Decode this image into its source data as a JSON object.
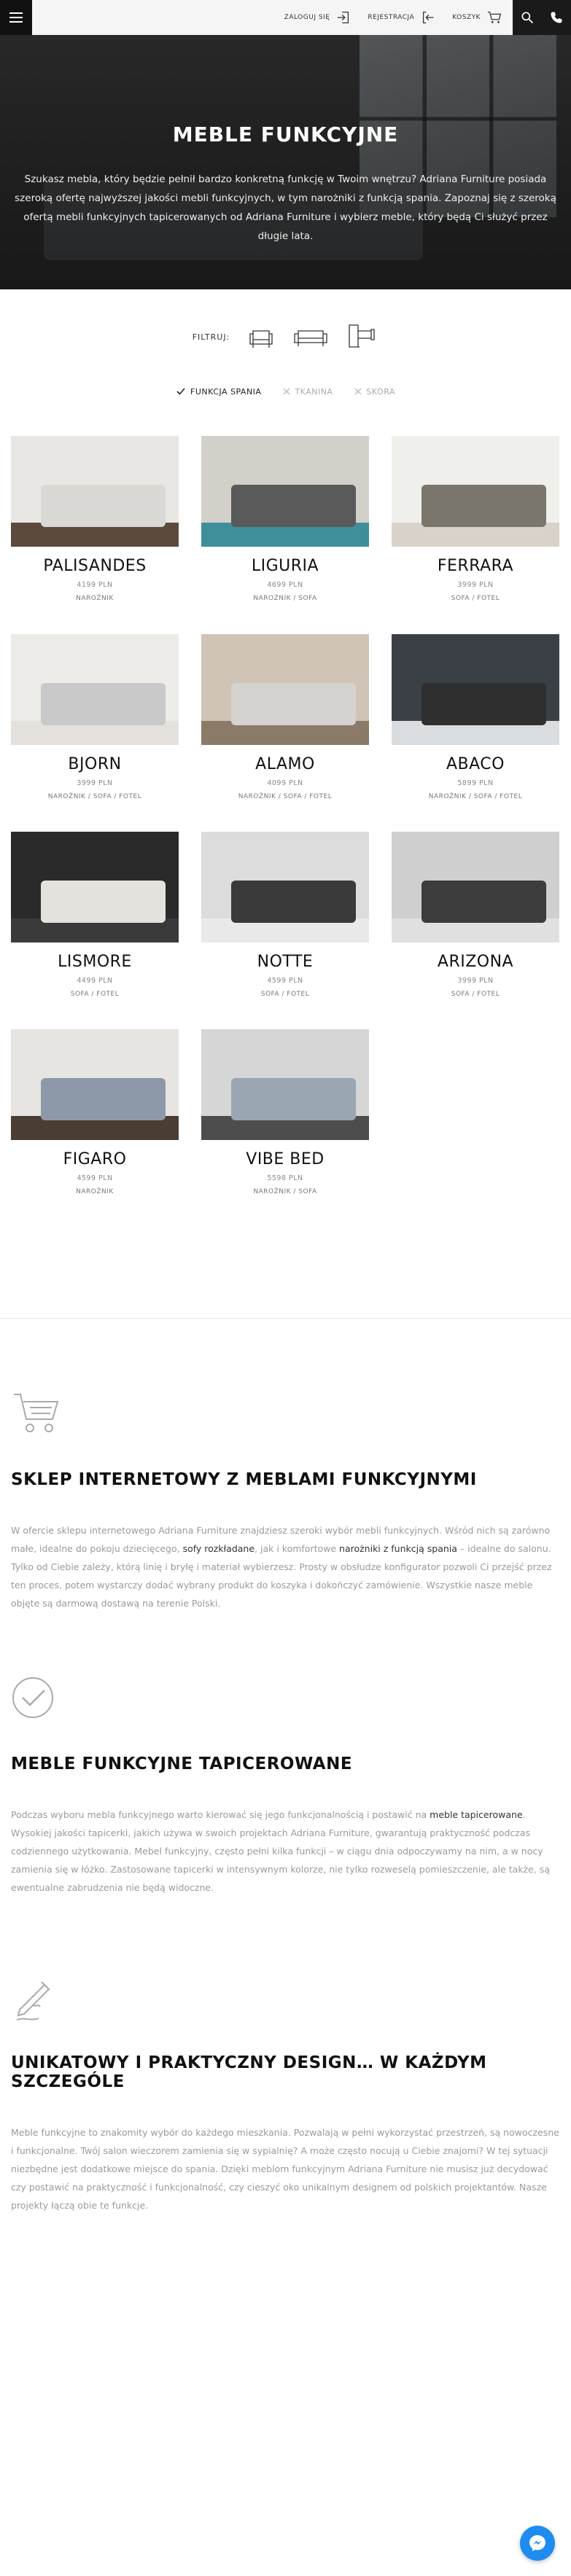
{
  "header": {
    "login_label": "ZALOGUJ SIĘ",
    "register_label": "REJESTRACJA",
    "cart_label": "KOSZYK"
  },
  "hero": {
    "title": "MEBLE FUNKCYJNE",
    "text": "Szukasz mebla, który będzie pełnił bardzo konkretną funkcję w Twoim wnętrzu? Adriana Furniture posiada szeroką ofertę najwyższej jakości mebli funkcyjnych, w tym narożniki z funkcją spania. Zapoznaj się z szeroką ofertą mebli funkcyjnych tapicerowanych od Adriana Furniture i wybierz meble, który będą Ci służyć przez długie lata."
  },
  "filter": {
    "label": "FILTRUJ:"
  },
  "tags": [
    {
      "label": "FUNKCJA SPANIA",
      "active": true
    },
    {
      "label": "TKANINA",
      "active": false
    },
    {
      "label": "SKÓRA",
      "active": false
    }
  ],
  "products": [
    {
      "name": "PALISANDES",
      "price": "4199 PLN",
      "type": "NAROŻNIK",
      "wall": "#e9e7e3",
      "sofa": "#d9d8d5",
      "floor": "#5b4a3d"
    },
    {
      "name": "LIGURIA",
      "price": "4699 PLN",
      "type": "NAROŻNIK / SOFA",
      "wall": "#d3d0ca",
      "sofa": "#5a5a5a",
      "floor": "#3f8f9b"
    },
    {
      "name": "FERRARA",
      "price": "3999 PLN",
      "type": "SOFA / FOTEL",
      "wall": "#efefec",
      "sofa": "#7a766c",
      "floor": "#d8d2c8"
    },
    {
      "name": "BJORN",
      "price": "3999 PLN",
      "type": "NAROŻNIK / SOFA / FOTEL",
      "wall": "#ecebe8",
      "sofa": "#c9c9c9",
      "floor": "#e4e1dc"
    },
    {
      "name": "ALAMO",
      "price": "4099 PLN",
      "type": "NAROŻNIK / SOFA / FOTEL",
      "wall": "#cfc4b6",
      "sofa": "#d5d3cf",
      "floor": "#8c7a68"
    },
    {
      "name": "ABACO",
      "price": "5899 PLN",
      "type": "NAROŻNIK / SOFA / FOTEL",
      "wall": "#3b3f46",
      "sofa": "#2f2f2f",
      "floor": "#d9dde0"
    },
    {
      "name": "LISMORE",
      "price": "4499 PLN",
      "type": "SOFA / FOTEL",
      "wall": "#2a2a2a",
      "sofa": "#e4e2dd",
      "floor": "#3a3a3a"
    },
    {
      "name": "NOTTE",
      "price": "4599 PLN",
      "type": "SOFA / FOTEL",
      "wall": "#dcdcdc",
      "sofa": "#3a3a3a",
      "floor": "#e9e9e9"
    },
    {
      "name": "ARIZONA",
      "price": "3999 PLN",
      "type": "SOFA / FOTEL",
      "wall": "#cfcfcf",
      "sofa": "#3c3c3c",
      "floor": "#e0e0e0"
    },
    {
      "name": "FIGARO",
      "price": "4599 PLN",
      "type": "NAROŻNIK",
      "wall": "#e7e5e1",
      "sofa": "#8d99a8",
      "floor": "#4a3d33"
    },
    {
      "name": "VIBE BED",
      "price": "5598 PLN",
      "type": "NAROŻNIK / SOFA",
      "wall": "#d6d6d6",
      "sofa": "#9aa6b1",
      "floor": "#4d4d4d"
    }
  ],
  "info": [
    {
      "icon": "cart-icon",
      "title": "SKLEP INTERNETOWY Z MEBLAMI FUNKCYJNYMI",
      "text_parts": [
        "W ofercie sklepu internetowego Adriana Furniture znajdziesz szeroki wybór mebli funkcyjnych. Wśród nich są zarówno małe, idealne do pokoju dziecięcego, ",
        "sofy rozkładane",
        ", jak i komfortowe ",
        "narożniki z funkcją spania",
        " – idealne do salonu. Tylko od Ciebie zależy, którą linię i bryłę i materiał wybierzesz. Prosty w obsłudze konfigurator pozwoli Ci przejść przez ten proces, potem wystarczy dodać wybrany produkt do koszyka i dokończyć zamówienie. Wszystkie nasze meble objęte są darmową dostawą na terenie Polski."
      ]
    },
    {
      "icon": "check-circle-icon",
      "title": "MEBLE FUNKCYJNE TAPICEROWANE",
      "text_parts": [
        "Podczas wyboru mebla funkcyjnego warto kierować się jego funkcjonalnością i postawić na ",
        "meble tapicerowane",
        ". Wysokiej jakości tapicerki, jakich używa w swoich projektach Adriana Furniture, gwarantują praktyczność podczas codziennego użytkowania. Mebel funkcyjny, często pełni kilka funkcji – w ciągu dnia odpoczywamy na nim, a w nocy zamienia się w łóżko. Zastosowane tapicerki w intensywnym kolorze, nie tylko rozweselą pomieszczenie, ale także, są ewentualne zabrudzenia nie będą widoczne."
      ]
    },
    {
      "icon": "pen-design-icon",
      "title": "UNIKATOWY I PRAKTYCZNY DESIGN… W KAŻDYM SZCZEGÓLE",
      "text_parts": [
        "Meble funkcyjne to znakomity wybór do każdego mieszkania. Pozwalają w pełni wykorzystać przestrzeń, są nowoczesne i funkcjonalne. Twój salon wieczorem zamienia się w sypialnię? A może często nocują u Ciebie znajomi? W tej sytuacji niezbędne jest dodatkowe miejsce do spania. Dzięki meblom funkcyjnym Adriana Furniture nie musisz już decydować czy postawić na praktyczność i funkcjonalność, czy cieszyć oko unikalnym designem od polskich projektantów. Nasze projekty łączą obie te funkcje."
      ]
    }
  ]
}
